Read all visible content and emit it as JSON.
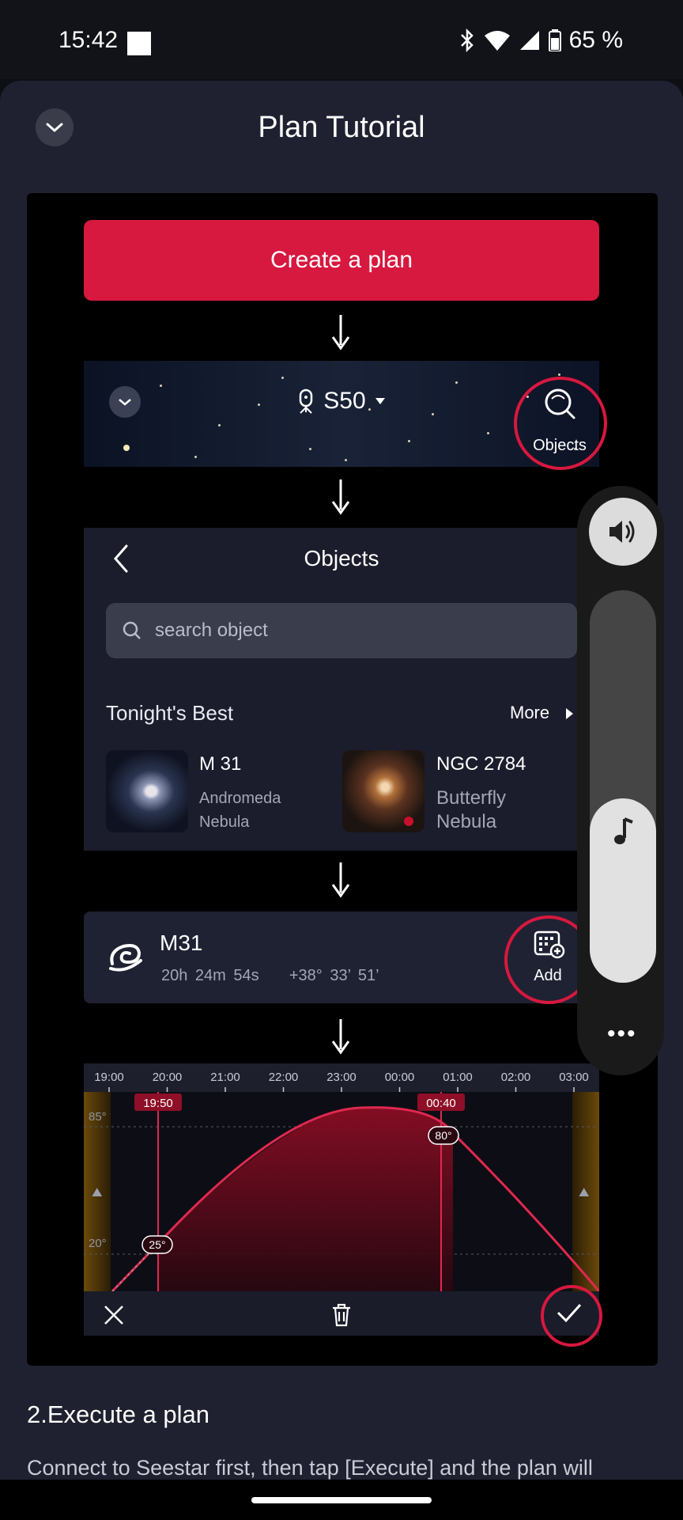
{
  "status_bar": {
    "time": "15:42",
    "battery": "65 %"
  },
  "sheet": {
    "title": "Plan Tutorial"
  },
  "tutorial": {
    "create_button": "Create a plan",
    "device": {
      "name": "S50"
    },
    "objects_button": "Objects",
    "objects_panel": {
      "title": "Objects",
      "search_placeholder": "search object",
      "section_title": "Tonight's Best",
      "more_label": "More",
      "items": [
        {
          "name": "M 31",
          "desc1": "Andromeda",
          "desc2": "Nebula"
        },
        {
          "name": "NGC 2784",
          "desc1": "Butterfly",
          "desc2": "Nebula"
        }
      ]
    },
    "target_card": {
      "name": "M31",
      "ra": "20h 24m 54s",
      "dec": "+38° 33’ 51’",
      "add_label": "Add"
    },
    "altitude_chart": {
      "times": [
        "19:00",
        "20:00",
        "21:00",
        "22:00",
        "23:00",
        "00:00",
        "01:00",
        "02:00",
        "03:00"
      ],
      "y_labels": [
        "85°",
        "20°"
      ],
      "start_marker": "19:50",
      "end_marker": "00:40",
      "start_alt": "25°",
      "end_alt": "80°"
    }
  },
  "volume": {
    "level": 0.47
  },
  "step": {
    "title": "2.Execute a plan",
    "text": "Connect to Seestar first, then tap [Execute] and the plan will"
  }
}
